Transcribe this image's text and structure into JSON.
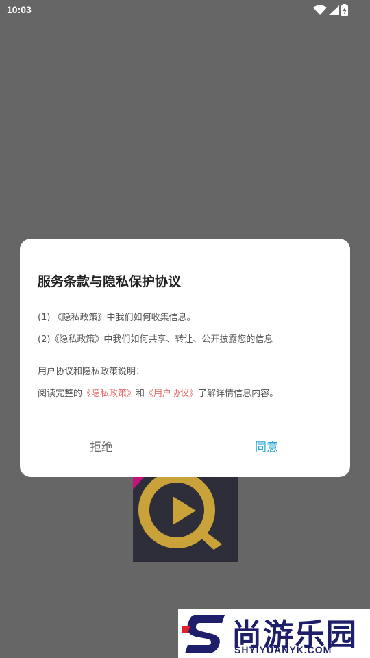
{
  "status_bar": {
    "time": "10:03",
    "icons": [
      "wifi-icon",
      "signal-icon",
      "battery-charging-icon"
    ]
  },
  "dialog": {
    "title": "服务条款与隐私保护协议",
    "line1": "(1) 《隐私政策》中我们如何收集信息。",
    "line2": "(2)《隐私政策》中我们如何共享、转让、公开披露您的信息",
    "line3": "用户协议和隐私政策说明：",
    "line4_prefix": "阅读完整的",
    "privacy_link": "《隐私政策》",
    "line4_and": "和",
    "user_agreement_link": "《用户协议》",
    "line4_suffix": "了解详情信息内容。",
    "reject_label": "拒绝",
    "agree_label": "同意"
  },
  "watermark": {
    "cn": "尚游乐园",
    "en": "SHYIYUANYK.COM"
  },
  "colors": {
    "overlay": "#666666",
    "link": "#e46a6a",
    "agree": "#2aa7d6",
    "watermark": "#1e1e6a",
    "logo_gold": "#c9a23a"
  }
}
